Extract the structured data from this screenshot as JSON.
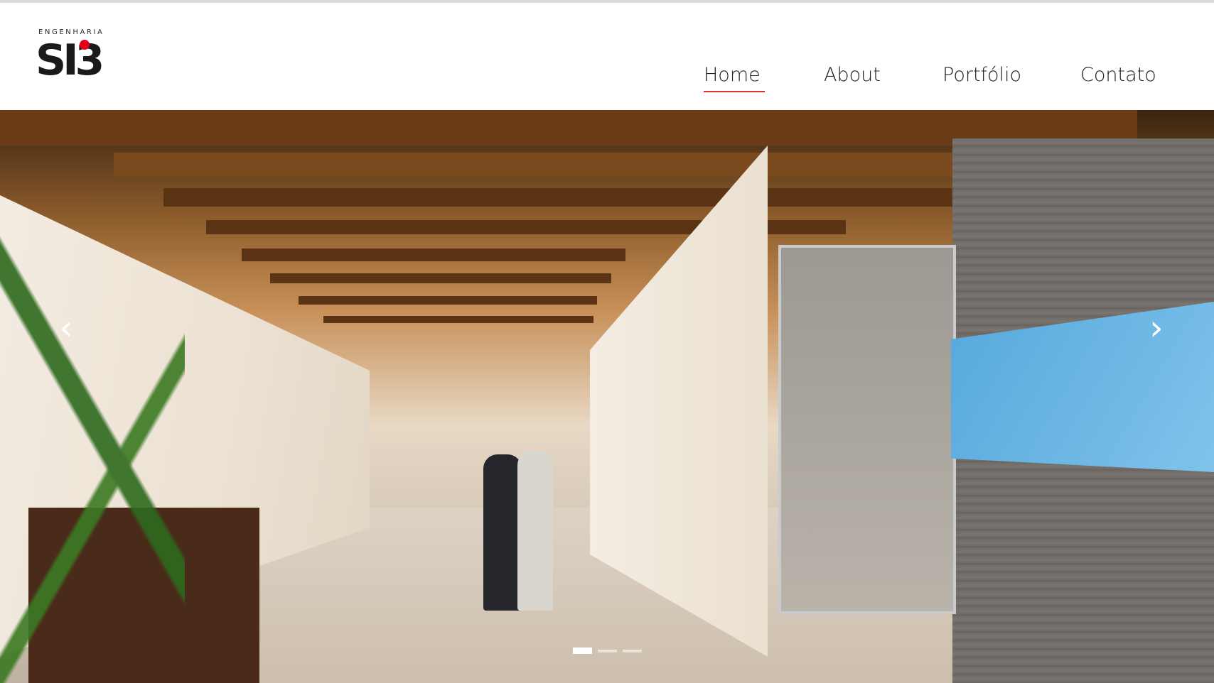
{
  "logo": {
    "small_text": "ENGENHARIA",
    "mark": "SI3"
  },
  "nav": {
    "items": [
      {
        "label": "Home",
        "active": true
      },
      {
        "label": "About",
        "active": false
      },
      {
        "label": "Portfólio",
        "active": false
      },
      {
        "label": "Contato",
        "active": false
      }
    ]
  },
  "slider": {
    "prev_icon": "chevron-left-icon",
    "next_icon": "chevron-right-icon",
    "slide_count": 3,
    "active_slide": 1
  },
  "colors": {
    "accent": "#d9342b",
    "text": "#222222"
  }
}
